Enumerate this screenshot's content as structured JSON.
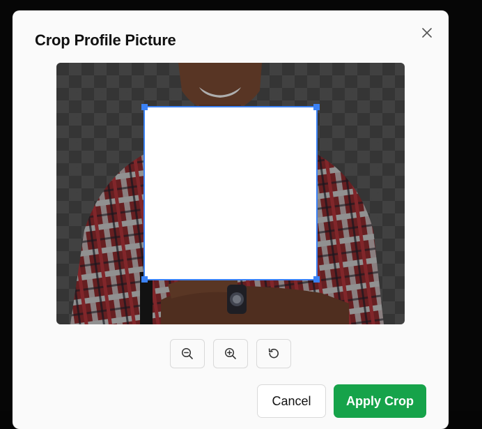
{
  "dialog": {
    "title": "Crop Profile Picture"
  },
  "toolbar": {
    "zoom_out_icon": "zoom-out-icon",
    "zoom_in_icon": "zoom-in-icon",
    "rotate_icon": "rotate-ccw-icon"
  },
  "actions": {
    "cancel_label": "Cancel",
    "apply_label": "Apply Crop"
  },
  "colors": {
    "accent": "#3b82f6",
    "apply": "#16a34a"
  }
}
